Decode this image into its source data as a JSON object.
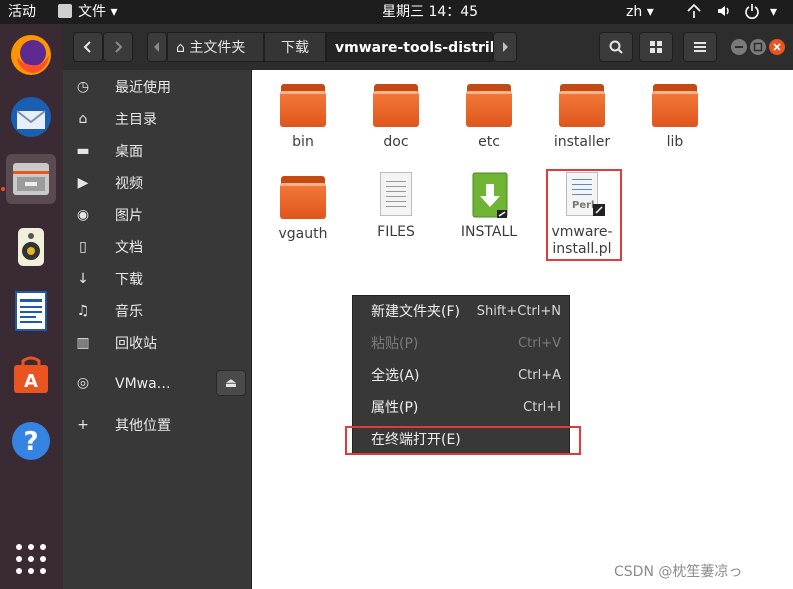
{
  "topbar": {
    "activities": "活动",
    "app_menu": "文件",
    "clock": "星期三 14：45",
    "input_method": "zh",
    "arrow": "▾"
  },
  "dock": {
    "items": [
      {
        "name": "firefox"
      },
      {
        "name": "thunderbird"
      },
      {
        "name": "files"
      },
      {
        "name": "rhythmbox"
      },
      {
        "name": "libreoffice-writer"
      },
      {
        "name": "ubuntu-software"
      },
      {
        "name": "help"
      }
    ]
  },
  "header": {
    "breadcrumbs": [
      "主文件夹",
      "下载",
      "vmware-tools-distrib"
    ]
  },
  "sidebar": {
    "items": [
      {
        "label": "最近使用",
        "icon": "clock-icon",
        "glyph": "◷"
      },
      {
        "label": "主目录",
        "icon": "home-icon",
        "glyph": "⌂"
      },
      {
        "label": "桌面",
        "icon": "desktop-icon",
        "glyph": "▬"
      },
      {
        "label": "视频",
        "icon": "video-icon",
        "glyph": "▶"
      },
      {
        "label": "图片",
        "icon": "camera-icon",
        "glyph": "◉"
      },
      {
        "label": "文档",
        "icon": "document-icon",
        "glyph": "▯"
      },
      {
        "label": "下载",
        "icon": "download-icon",
        "glyph": "↓"
      },
      {
        "label": "音乐",
        "icon": "music-icon",
        "glyph": "♫"
      },
      {
        "label": "回收站",
        "icon": "trash-icon",
        "glyph": "▥"
      },
      {
        "label": "VMwa…",
        "icon": "disc-icon",
        "glyph": "◎"
      },
      {
        "label": "其他位置",
        "icon": "plus-icon",
        "glyph": "+"
      }
    ],
    "eject_glyph": "⏏"
  },
  "files": [
    {
      "name": "bin",
      "type": "folder"
    },
    {
      "name": "doc",
      "type": "folder"
    },
    {
      "name": "etc",
      "type": "folder"
    },
    {
      "name": "installer",
      "type": "folder"
    },
    {
      "name": "lib",
      "type": "folder"
    },
    {
      "name": "vgauth",
      "type": "folder"
    },
    {
      "name": "FILES",
      "type": "text"
    },
    {
      "name": "INSTALL",
      "type": "download"
    },
    {
      "name": "vmware-install.pl",
      "line1": "vmware-",
      "line2": "install.pl",
      "type": "perl",
      "badge": "Perl"
    }
  ],
  "context_menu": {
    "items": [
      {
        "label": "新建文件夹(F)",
        "accel": "Shift+Ctrl+N",
        "enabled": true
      },
      {
        "label": "粘贴(P)",
        "accel": "Ctrl+V",
        "enabled": false
      },
      {
        "label": "全选(A)",
        "accel": "Ctrl+A",
        "enabled": true
      },
      {
        "label": "属性(P)",
        "accel": "Ctrl+I",
        "enabled": true
      },
      {
        "label": "在终端打开(E)",
        "accel": "",
        "enabled": true
      }
    ]
  },
  "watermark": "CSDN @枕笙萋凉っ",
  "colors": {
    "accent": "#e95420",
    "highlight_box": "#e23a3a"
  }
}
